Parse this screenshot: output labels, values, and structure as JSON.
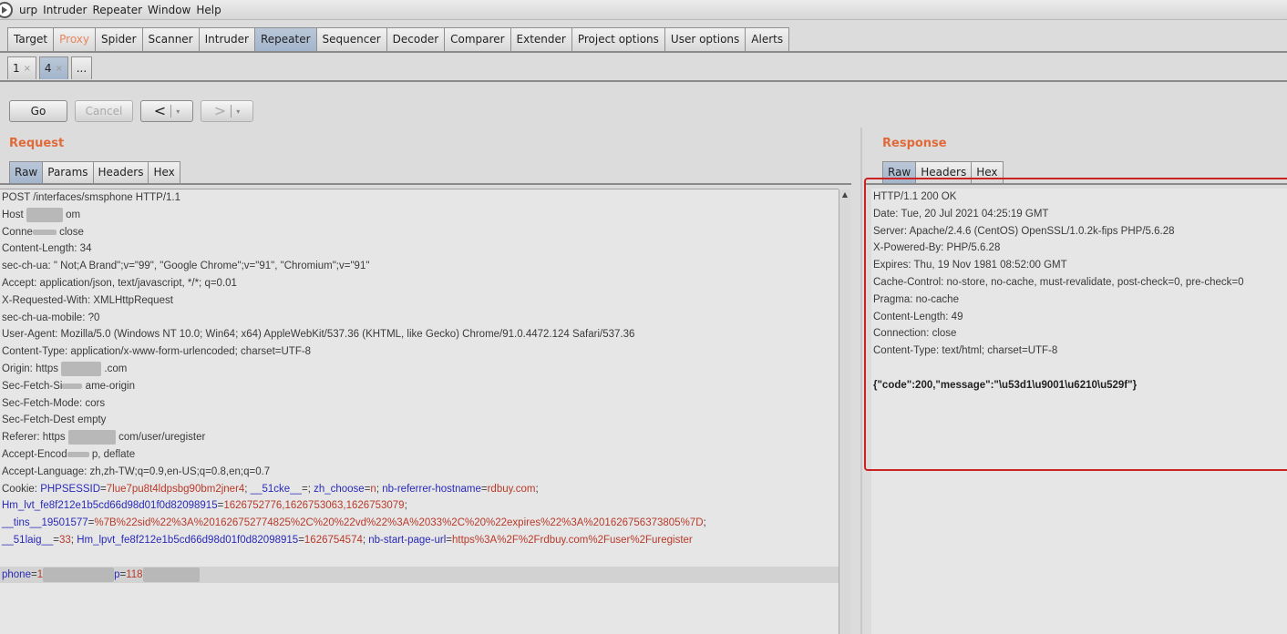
{
  "menu": [
    "urp",
    "Intruder",
    "Repeater",
    "Window",
    "Help"
  ],
  "tabs": [
    "Target",
    "Proxy",
    "Spider",
    "Scanner",
    "Intruder",
    "Repeater",
    "Sequencer",
    "Decoder",
    "Comparer",
    "Extender",
    "Project options",
    "User options",
    "Alerts"
  ],
  "subtabs": {
    "t1": "1",
    "t2": "4",
    "more": "...",
    "close": "×"
  },
  "toolbar": {
    "go": "Go",
    "cancel": "Cancel",
    "back": "<",
    "forward": ">",
    "caret": "▾"
  },
  "request": {
    "title": "Request",
    "tabs": [
      "Raw",
      "Params",
      "Headers",
      "Hex"
    ],
    "lines": {
      "l1": "POST /interfaces/smsphone HTTP/1.1",
      "l2a": "Host",
      "l2b": "om",
      "l3a": "Conne",
      "l3b": "close",
      "l4": "Content-Length: 34",
      "l5": "sec-ch-ua: \" Not;A Brand\";v=\"99\", \"Google Chrome\";v=\"91\", \"Chromium\";v=\"91\"",
      "l6": "Accept: application/json, text/javascript, */*; q=0.01",
      "l7": "X-Requested-With: XMLHttpRequest",
      "l8": "sec-ch-ua-mobile: ?0",
      "l9": "User-Agent: Mozilla/5.0 (Windows NT 10.0; Win64; x64) AppleWebKit/537.36 (KHTML, like Gecko) Chrome/91.0.4472.124 Safari/537.36",
      "l10": "Content-Type: application/x-www-form-urlencoded; charset=UTF-8",
      "l11a": "Origin: https",
      "l11b": ".com",
      "l12a": "Sec-Fetch-Si",
      "l12b": "ame-origin",
      "l13": "Sec-Fetch-Mode: cors",
      "l14a": "Sec-Fetch-Dest",
      "l14b": "empty",
      "l15a": "Referer: https",
      "l15b": "com/user/uregister",
      "l16a": "Accept-Encod",
      "l16b": "p, deflate",
      "l17": "Accept-Language: zh,zh-TW;q=0.9,en-US;q=0.8,en;q=0.7",
      "cookie_label": "Cookie:",
      "c1": "PHPSESSID",
      "c1v": "7lue7pu8t4ldpsbg90bm2jner4",
      "c2": "__51cke__",
      "c2v": "",
      "c3": "zh_choose",
      "c3v": "n",
      "c4": "nb-referrer-hostname",
      "c4v": "rdbuy.com",
      "c5": "Hm_lvt_fe8f212e1b5cd66d98d01f0d82098915",
      "c5v": "1626752776,1626753063,1626753079",
      "c6": "__tins__19501577",
      "c6v": "%7B%22sid%22%3A%201626752774825%2C%20%22vd%22%3A%2033%2C%20%22expires%22%3A%201626756373805%7D",
      "c7": "__51laig__",
      "c7v": "33",
      "c8": "Hm_lpvt_fe8f212e1b5cd66d98d01f0d82098915",
      "c8v": "1626754574",
      "c9": "nb-start-page-url",
      "c9v": "https%3A%2F%2Frdbuy.com%2Fuser%2Furegister",
      "body_a": "phone",
      "body_av": "1",
      "body_b": "p",
      "body_bv": "118"
    }
  },
  "response": {
    "title": "Response",
    "tabs": [
      "Raw",
      "Headers",
      "Hex"
    ],
    "lines": [
      "HTTP/1.1 200 OK",
      "Date: Tue, 20 Jul 2021 04:25:19 GMT",
      "Server: Apache/2.4.6 (CentOS) OpenSSL/1.0.2k-fips PHP/5.6.28",
      "X-Powered-By: PHP/5.6.28",
      "Expires: Thu, 19 Nov 1981 08:52:00 GMT",
      "Cache-Control: no-store, no-cache, must-revalidate, post-check=0, pre-check=0",
      "Pragma: no-cache",
      "Content-Length: 49",
      "Connection: close",
      "Content-Type: text/html; charset=UTF-8"
    ],
    "body": "{\"code\":200,\"message\":\"\\u53d1\\u9001\\u6210\\u529f\"}"
  },
  "colors": {
    "accent": "#e06a3a",
    "highlight_box": "#cc2222",
    "param_name": "#2a2ab8",
    "param_value": "#b83a2a"
  }
}
